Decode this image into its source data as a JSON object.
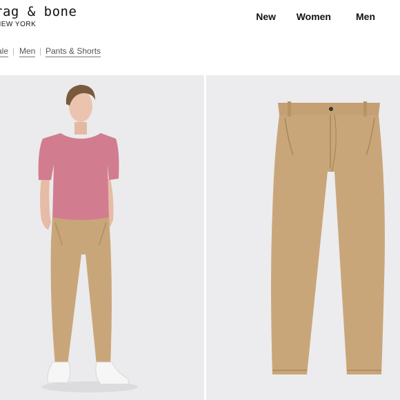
{
  "brand": {
    "logo_main": "rag & bone",
    "logo_sub": "NEW YORK"
  },
  "nav": {
    "items": [
      {
        "label": "New"
      },
      {
        "label": "Women"
      },
      {
        "label": "Men"
      }
    ]
  },
  "breadcrumb": {
    "items": [
      {
        "label": "Sale"
      },
      {
        "label": "Men"
      },
      {
        "label": "Pants & Shorts"
      }
    ]
  },
  "product": {
    "shirt_color": "#d27d8f",
    "pants_color": "#c9a67a",
    "sneaker_color": "#f6f6f6",
    "background_color": "#ebebed"
  }
}
